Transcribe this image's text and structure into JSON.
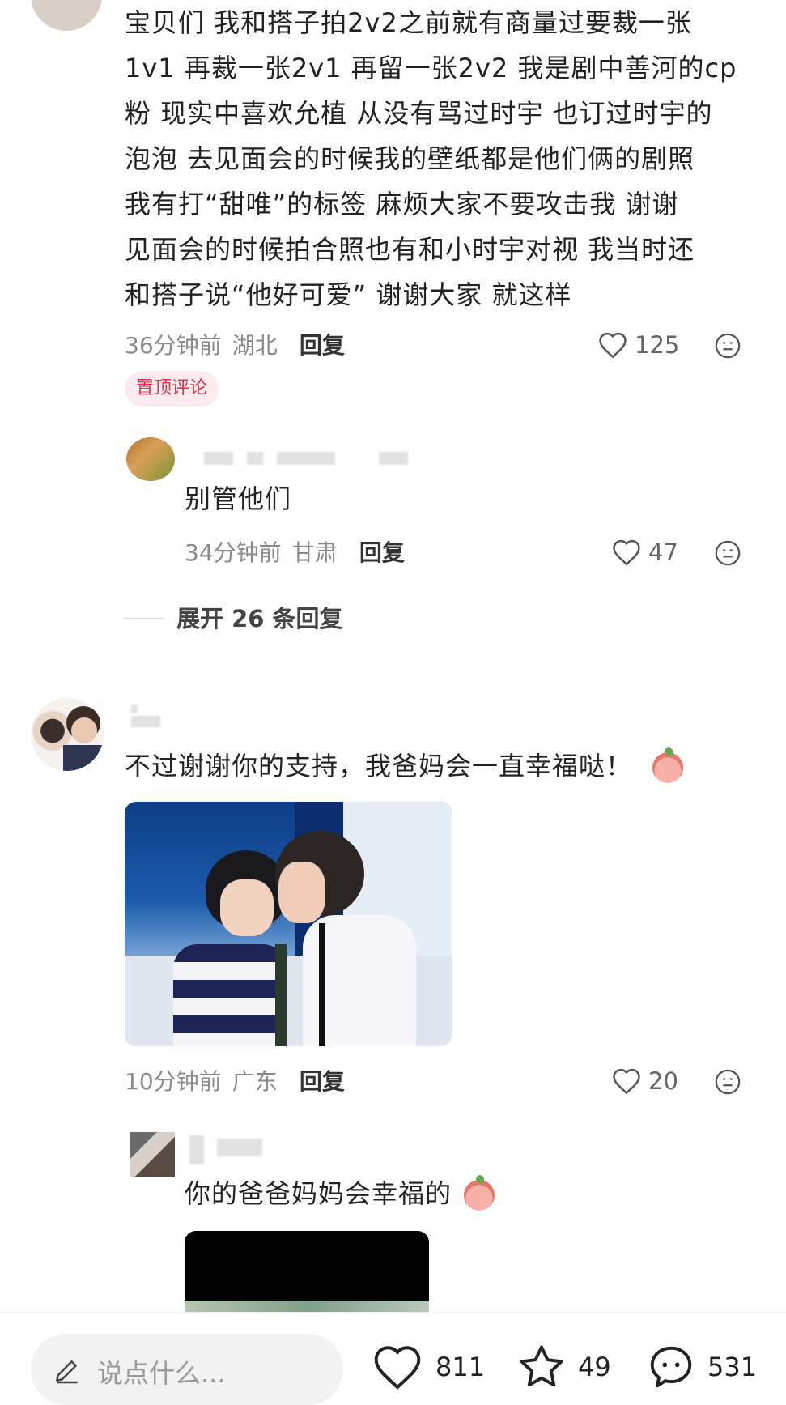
{
  "top_comment": {
    "lines": [
      "宝贝们 我和搭子拍2v2之前就有商量过要裁一张",
      "1v1 再裁一张2v1 再留一张2v2 我是剧中善河的cp",
      "粉 现实中喜欢允植 从没有骂过时宇 也订过时宇的",
      "泡泡 去见面会的时候我的壁纸都是他们俩的剧照",
      "我有打“甜唯”的标签 麻烦大家不要攻击我 谢谢",
      "见面会的时候拍合照也有和小时宇对视 我当时还",
      "和搭子说“他好可爱” 谢谢大家 就这样"
    ],
    "time": "36分钟前",
    "location": "湖北",
    "reply_label": "回复",
    "likes": "125",
    "pin_badge": "置顶评论"
  },
  "sub_reply_1": {
    "text": "别管他们",
    "time": "34分钟前",
    "location": "甘肃",
    "reply_label": "回复",
    "likes": "47"
  },
  "expand": {
    "label": "展开 26 条回复"
  },
  "comment_2": {
    "text": "不过谢谢你的支持，我爸妈会一直幸福哒！",
    "time": "10分钟前",
    "location": "广东",
    "reply_label": "回复",
    "likes": "20"
  },
  "sub_reply_2": {
    "text": "你的爸爸妈妈会幸福的"
  },
  "bottom_bar": {
    "input_placeholder": "说点什么...",
    "likes": "811",
    "stars": "49",
    "comments": "531"
  },
  "icons": {
    "heart": "heart-icon",
    "emoji": "emoji-face-icon",
    "pencil": "pencil-icon",
    "star": "star-icon",
    "chat": "chat-bubble-icon"
  },
  "colors": {
    "pin_badge_bg": "#fdecef",
    "pin_badge_text": "#e0304e",
    "meta_gray": "#8a8a8a"
  }
}
